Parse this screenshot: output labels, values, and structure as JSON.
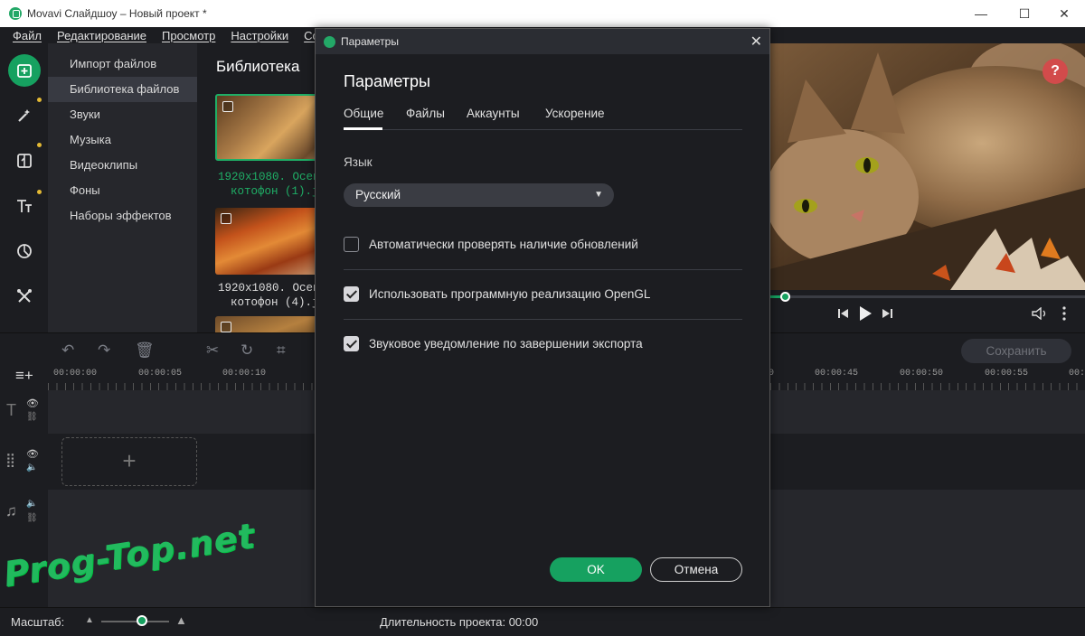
{
  "window": {
    "title": "Movavi Слайдшоу – Новый проект *"
  },
  "menu": [
    "Файл",
    "Редактирование",
    "Просмотр",
    "Настройки",
    "Со"
  ],
  "sidebar": {
    "items": [
      "Импорт файлов",
      "Библиотека файлов",
      "Звуки",
      "Музыка",
      "Видеоклипы",
      "Фоны",
      "Наборы эффектов"
    ],
    "active_index": 1
  },
  "library": {
    "title": "Библиотека",
    "items": [
      {
        "line1": "1920x1080. Осен",
        "line2": "котофон (1).jp"
      },
      {
        "line1": "1920x1080. Осен",
        "line2": "котофон (4).jp"
      }
    ]
  },
  "preview": {
    "help": "?",
    "progress": 0.05
  },
  "timeline": {
    "save_label": "Сохранить",
    "ruler_ticks": [
      "00:00:00",
      "00:00:05",
      "00:00:10",
      "0",
      "00:00:45",
      "00:00:50",
      "00:00:55",
      "00:01"
    ],
    "add_clip": "+"
  },
  "status": {
    "scale_label": "Масштаб:",
    "scale_value": 0.6,
    "duration_label": "Длительность проекта:",
    "duration_value": "00:00"
  },
  "watermark": "Prog-Top.net",
  "dialog": {
    "title": "Параметры",
    "heading": "Параметры",
    "tabs": [
      "Общие",
      "Файлы",
      "Аккаунты",
      "Ускорение"
    ],
    "active_tab": 0,
    "language_label": "Язык",
    "language_value": "Русский",
    "options": [
      {
        "label": "Автоматически проверять наличие обновлений",
        "checked": false
      },
      {
        "label": "Использовать программную реализацию OpenGL",
        "checked": true
      },
      {
        "label": "Звуковое уведомление по завершении экспорта",
        "checked": true
      }
    ],
    "ok_label": "OK",
    "cancel_label": "Отмена"
  },
  "colors": {
    "accent": "#16a160",
    "help": "#d24b4b",
    "dot": "#e3b934"
  },
  "icons": [
    "import-icon",
    "magic-wand-icon",
    "transition-icon",
    "text-icon",
    "filter-icon",
    "tools-icon",
    "undo-icon",
    "redo-icon",
    "delete-icon",
    "cut-icon",
    "rotate-icon",
    "crop-icon",
    "add-track-icon",
    "eye-icon",
    "speaker-icon",
    "music-note-icon"
  ]
}
